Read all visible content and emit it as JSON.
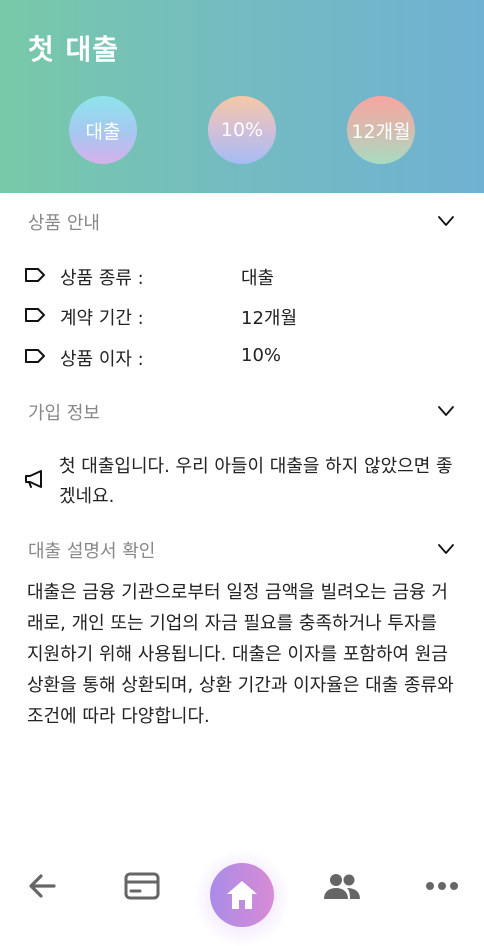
{
  "header": {
    "title": "첫 대출",
    "badges": [
      "대출",
      "10%",
      "12개월"
    ]
  },
  "product_info": {
    "heading": "상품 안내",
    "rows": [
      {
        "label": "상품 종류 :",
        "value": "대출"
      },
      {
        "label": "계약 기간 :",
        "value": "12개월"
      },
      {
        "label": "상품 이자 :",
        "value": "10%"
      }
    ]
  },
  "join_info": {
    "heading": "가입 정보",
    "message": "첫 대출입니다. 우리 아들이 대출을 하지 않았으면 좋겠네요."
  },
  "loan_doc": {
    "heading": "대출 설명서 확인",
    "body": "대출은 금융 기관으로부터 일정 금액을 빌려오는 금융 거래로, 개인 또는 기업의 자금 필요를 충족하거나 투자를 지원하기 위해 사용됩니다. 대출은 이자를 포함하여 원금 상환을 통해 상환되며, 상환 기간과 이자율은 대출 종류와 조건에 따라 다양합니다."
  },
  "bottom_nav": {
    "items": [
      "back-arrow-icon",
      "card-icon",
      "home-icon",
      "people-icon",
      "more-icon"
    ]
  },
  "colors": {
    "header_start": "#78c9a8",
    "header_end": "#6fb1d2",
    "muted_heading": "#888888",
    "nav_icon": "#666666",
    "home_start": "#a98ce8",
    "home_end": "#d88bd5"
  }
}
